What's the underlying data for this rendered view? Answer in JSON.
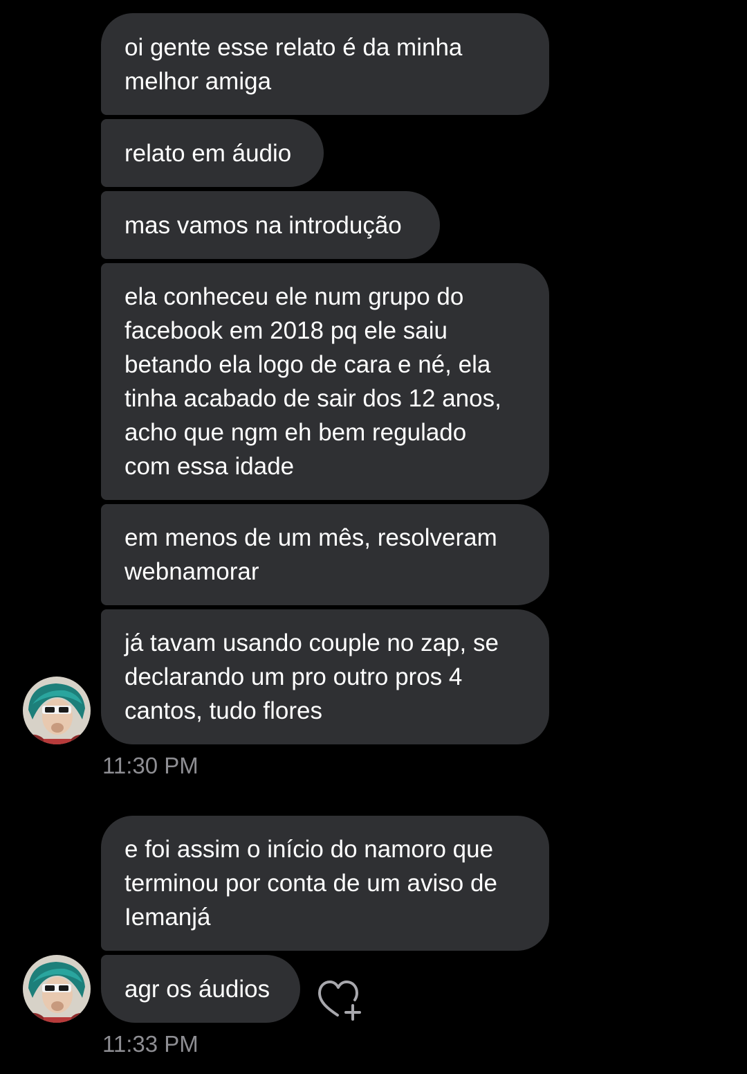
{
  "messages": [
    {
      "text": "oi gente esse relato é da minha\nmelhor amiga"
    },
    {
      "text": "relato em áudio"
    },
    {
      "text": "mas vamos na introdução"
    },
    {
      "text": "ela conheceu ele num grupo do\nfacebook em 2018 pq ele saiu\nbetando ela logo de cara e né, ela\ntinha acabado de sair dos 12 anos,\nacho que ngm eh bem regulado\ncom essa idade"
    },
    {
      "text": "em menos de um mês, resolveram\nwebnamorar"
    },
    {
      "text": "já tavam usando couple no zap, se\ndeclarando um pro outro pros 4\ncantos, tudo flores"
    },
    {
      "text": "e foi assim o início do namoro que\nterminou por conta de um aviso de\nIemanjá"
    },
    {
      "text": "agr os áudios"
    }
  ],
  "timestamps": [
    "11:30 PM",
    "11:33 PM"
  ],
  "icons": {
    "avatar": "profile-avatar",
    "react": "heart-plus-icon"
  },
  "colors": {
    "background": "#000000",
    "bubble": "#2f3033",
    "text": "#ffffff",
    "timestamp": "#8e8e93"
  }
}
